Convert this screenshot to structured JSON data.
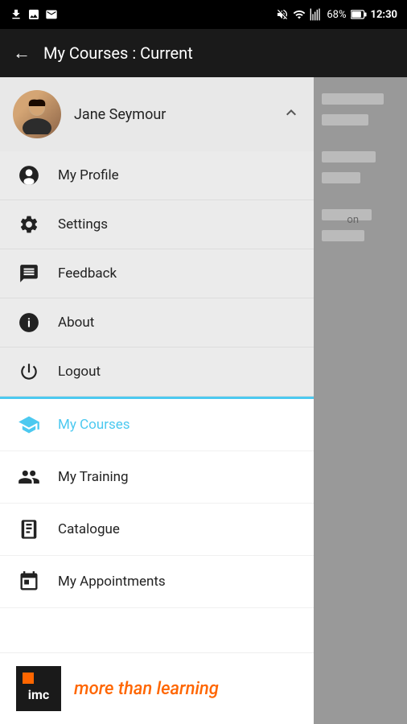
{
  "statusBar": {
    "battery": "68%",
    "time": "12:30",
    "icons": [
      "download-icon",
      "image-icon",
      "email-icon",
      "mute-icon",
      "wifi-icon",
      "signal-icon",
      "battery-icon"
    ]
  },
  "header": {
    "back_label": "←",
    "title": "My Courses : Current"
  },
  "user": {
    "name": "Jane Seymour"
  },
  "menuItems": [
    {
      "id": "profile",
      "label": "My Profile",
      "icon": "person-icon"
    },
    {
      "id": "settings",
      "label": "Settings",
      "icon": "gear-icon"
    },
    {
      "id": "feedback",
      "label": "Feedback",
      "icon": "feedback-icon"
    },
    {
      "id": "about",
      "label": "About",
      "icon": "info-icon"
    },
    {
      "id": "logout",
      "label": "Logout",
      "icon": "power-icon"
    }
  ],
  "navItems": [
    {
      "id": "my-courses",
      "label": "My Courses",
      "icon": "graduation-icon",
      "active": true
    },
    {
      "id": "my-training",
      "label": "My Training",
      "icon": "training-icon",
      "active": false
    },
    {
      "id": "catalogue",
      "label": "Catalogue",
      "icon": "book-icon",
      "active": false
    },
    {
      "id": "my-appointments",
      "label": "My Appointments",
      "icon": "calendar-icon",
      "active": false
    }
  ],
  "logo": {
    "tagline": "more than learning",
    "brand": "imc"
  },
  "rightOverlay": {
    "label": "on"
  }
}
